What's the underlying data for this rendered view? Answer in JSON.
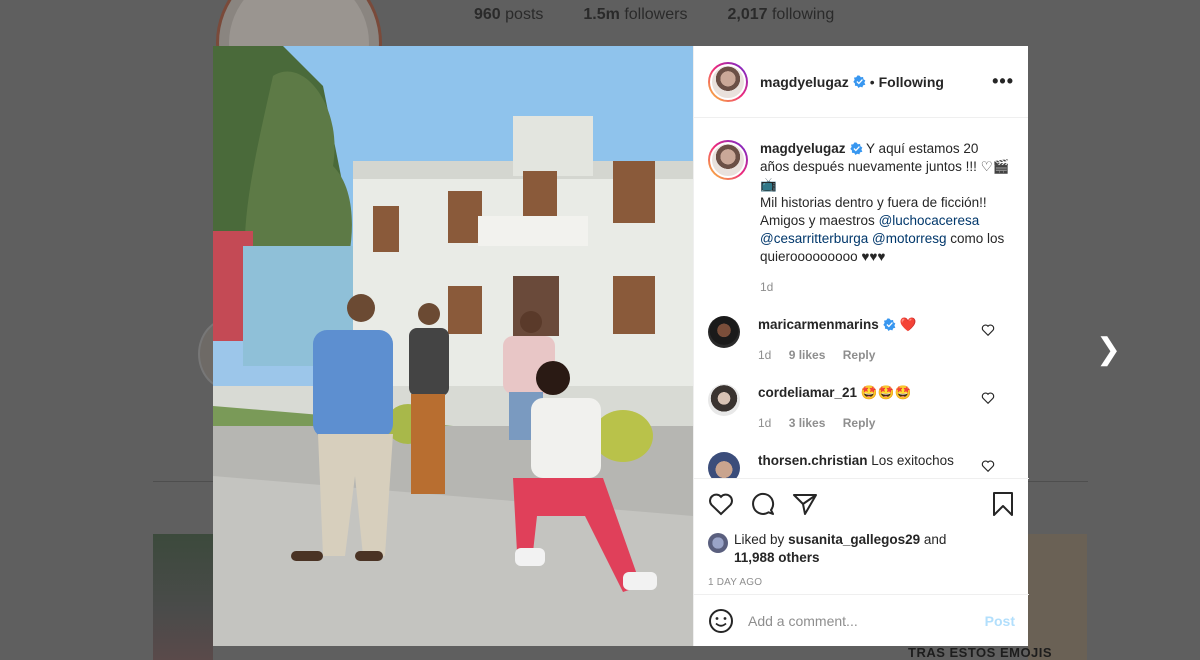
{
  "profile": {
    "posts": "960",
    "posts_label": "posts",
    "followers": "1.5m",
    "followers_label": "followers",
    "following": "2,017",
    "following_label": "following"
  },
  "background": {
    "thumb_caption": "TRAS ESTOS EMOJIS"
  },
  "post": {
    "author": "magdyelugaz",
    "separator": "•",
    "follow_status": "Following",
    "more_icon": "more-horizontal-icon",
    "caption": {
      "part1": "Y aquí estamos 20 años después nuevamente juntos !!! ♡🎬📺",
      "part2": "Mil historias dentro y fuera de ficción!! Amigos y maestros",
      "mention1": "@luchocaceresa",
      "mention2": "@cesarritterburga",
      "mention3": "@motorresg",
      "part3": "como los quierooooooooo ♥♥♥",
      "age": "1d"
    },
    "comments": [
      {
        "user": "maricarmenmarins",
        "text": "❤️",
        "age": "1d",
        "likes": "9 likes",
        "reply": "Reply",
        "verified": true
      },
      {
        "user": "cordeliamar_21",
        "text": "🤩🤩🤩",
        "age": "1d",
        "likes": "3 likes",
        "reply": "Reply",
        "verified": false
      },
      {
        "user": "thorsen.christian",
        "text": "Los exitochos",
        "age": "",
        "likes": "",
        "reply": "",
        "verified": false
      }
    ],
    "liked_by_prefix": "Liked by",
    "liked_by_user": "susanita_gallegos29",
    "liked_by_and": "and",
    "liked_by_others": "11,988 others",
    "timestamp": "1 DAY AGO",
    "add_comment_placeholder": "Add a comment...",
    "post_button": "Post"
  },
  "colors": {
    "verified": "#3897f0",
    "link": "#00376b",
    "post_button": "#b2dffc",
    "heart_red": "#ed4956"
  }
}
